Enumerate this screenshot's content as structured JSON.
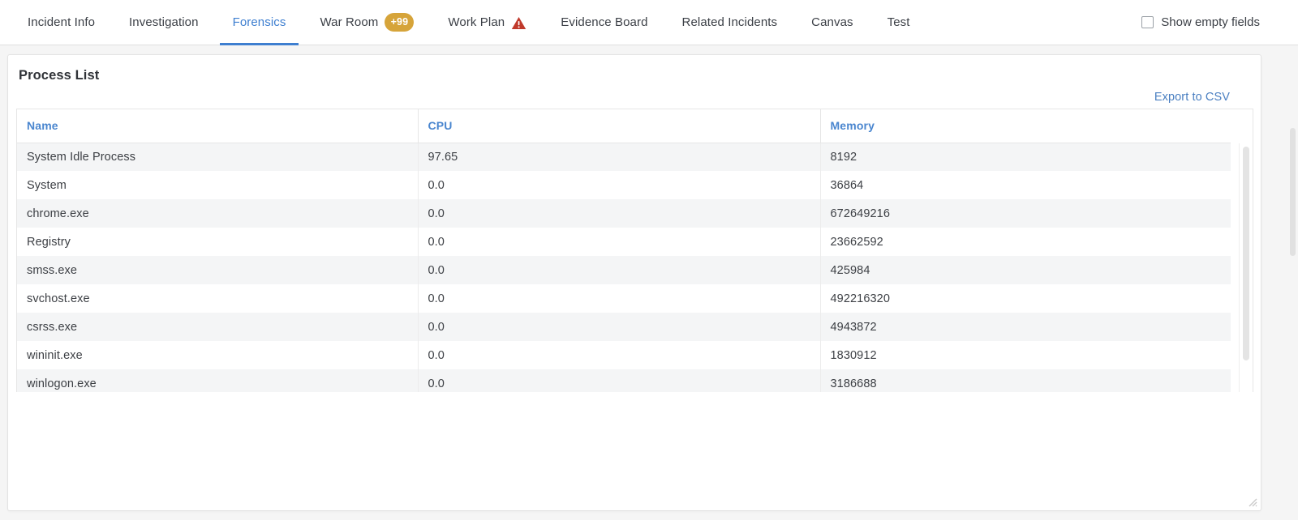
{
  "tabbar": {
    "tabs": [
      {
        "label": "Incident Info",
        "active": false
      },
      {
        "label": "Investigation",
        "active": false
      },
      {
        "label": "Forensics",
        "active": true
      },
      {
        "label": "War Room",
        "active": false,
        "badge": "+99"
      },
      {
        "label": "Work Plan",
        "active": false,
        "warning": true
      },
      {
        "label": "Evidence Board",
        "active": false
      },
      {
        "label": "Related Incidents",
        "active": false
      },
      {
        "label": "Canvas",
        "active": false
      },
      {
        "label": "Test",
        "active": false
      }
    ],
    "show_empty_fields_label": "Show empty fields",
    "show_empty_fields_checked": false,
    "active_color": "#3e7fd0",
    "badge_color": "#d6a43a",
    "warning_color": "#c0392b"
  },
  "card": {
    "title": "Process List",
    "export_label": "Export to CSV",
    "export_color": "#4a7fc1"
  },
  "table": {
    "columns": [
      "Name",
      "CPU",
      "Memory"
    ],
    "header_color": "#4a86cf",
    "rows": [
      {
        "name": "System Idle Process",
        "cpu": "97.65",
        "memory": "8192"
      },
      {
        "name": "System",
        "cpu": "0.0",
        "memory": "36864"
      },
      {
        "name": "chrome.exe",
        "cpu": "0.0",
        "memory": "672649216"
      },
      {
        "name": "Registry",
        "cpu": "0.0",
        "memory": "23662592"
      },
      {
        "name": "smss.exe",
        "cpu": "0.0",
        "memory": "425984"
      },
      {
        "name": "svchost.exe",
        "cpu": "0.0",
        "memory": "492216320"
      },
      {
        "name": "csrss.exe",
        "cpu": "0.0",
        "memory": "4943872"
      },
      {
        "name": "wininit.exe",
        "cpu": "0.0",
        "memory": "1830912"
      },
      {
        "name": "winlogon.exe",
        "cpu": "0.0",
        "memory": "3186688"
      }
    ]
  }
}
